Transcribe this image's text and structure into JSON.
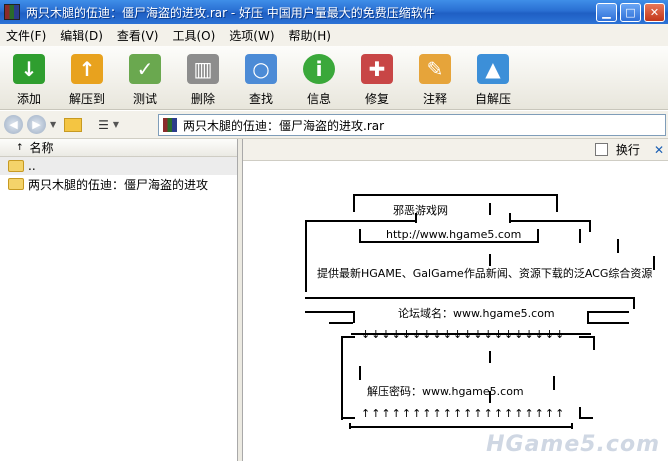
{
  "window": {
    "title": "两只木腿的伍迪：僵尸海盗的进攻.rar - 好压 中国用户量最大的免费压缩软件"
  },
  "menu": [
    "文件(F)",
    "编辑(D)",
    "查看(V)",
    "工具(O)",
    "选项(W)",
    "帮助(H)"
  ],
  "toolbar": [
    {
      "label": "添加",
      "icon": "add-icon",
      "color": "#2f9e2f"
    },
    {
      "label": "解压到",
      "icon": "extract-to-icon",
      "color": "#e8a21e"
    },
    {
      "label": "测试",
      "icon": "test-icon",
      "color": "#6aa84f"
    },
    {
      "label": "删除",
      "icon": "delete-icon",
      "color": "#8d8d8d"
    },
    {
      "label": "查找",
      "icon": "find-icon",
      "color": "#4c8bd6"
    },
    {
      "label": "信息",
      "icon": "info-icon",
      "color": "#3aa83a"
    },
    {
      "label": "修复",
      "icon": "repair-icon",
      "color": "#c84646"
    },
    {
      "label": "注释",
      "icon": "comment-icon",
      "color": "#e6a43a"
    },
    {
      "label": "自解压",
      "icon": "sfx-icon",
      "color": "#3c8fd8"
    }
  ],
  "address": {
    "path": "两只木腿的伍迪：僵尸海盗的进攻.rar"
  },
  "file_list": {
    "header": "名称",
    "items": [
      {
        "name": ".."
      },
      {
        "name": "两只木腿的伍迪：僵尸海盗的进攻"
      }
    ]
  },
  "comment": {
    "wrap_label": "换行",
    "line1": "邪恶游戏网",
    "line2": "http://www.hgame5.com",
    "line3": "提供最新HGAME、GalGame作品新闻、资源下载的泛ACG综合资源",
    "line4": "论坛域名：www.hgame5.com",
    "down_arrows": "↓↓↓↓↓↓↓↓↓↓↓↓↓↓↓↓↓↓↓↓",
    "line5": "解压密码：www.hgame5.com",
    "up_arrows": "↑↑↑↑↑↑↑↑↑↑↑↑↑↑↑↑↑↑↑↑"
  },
  "watermark": "HGame5.com"
}
